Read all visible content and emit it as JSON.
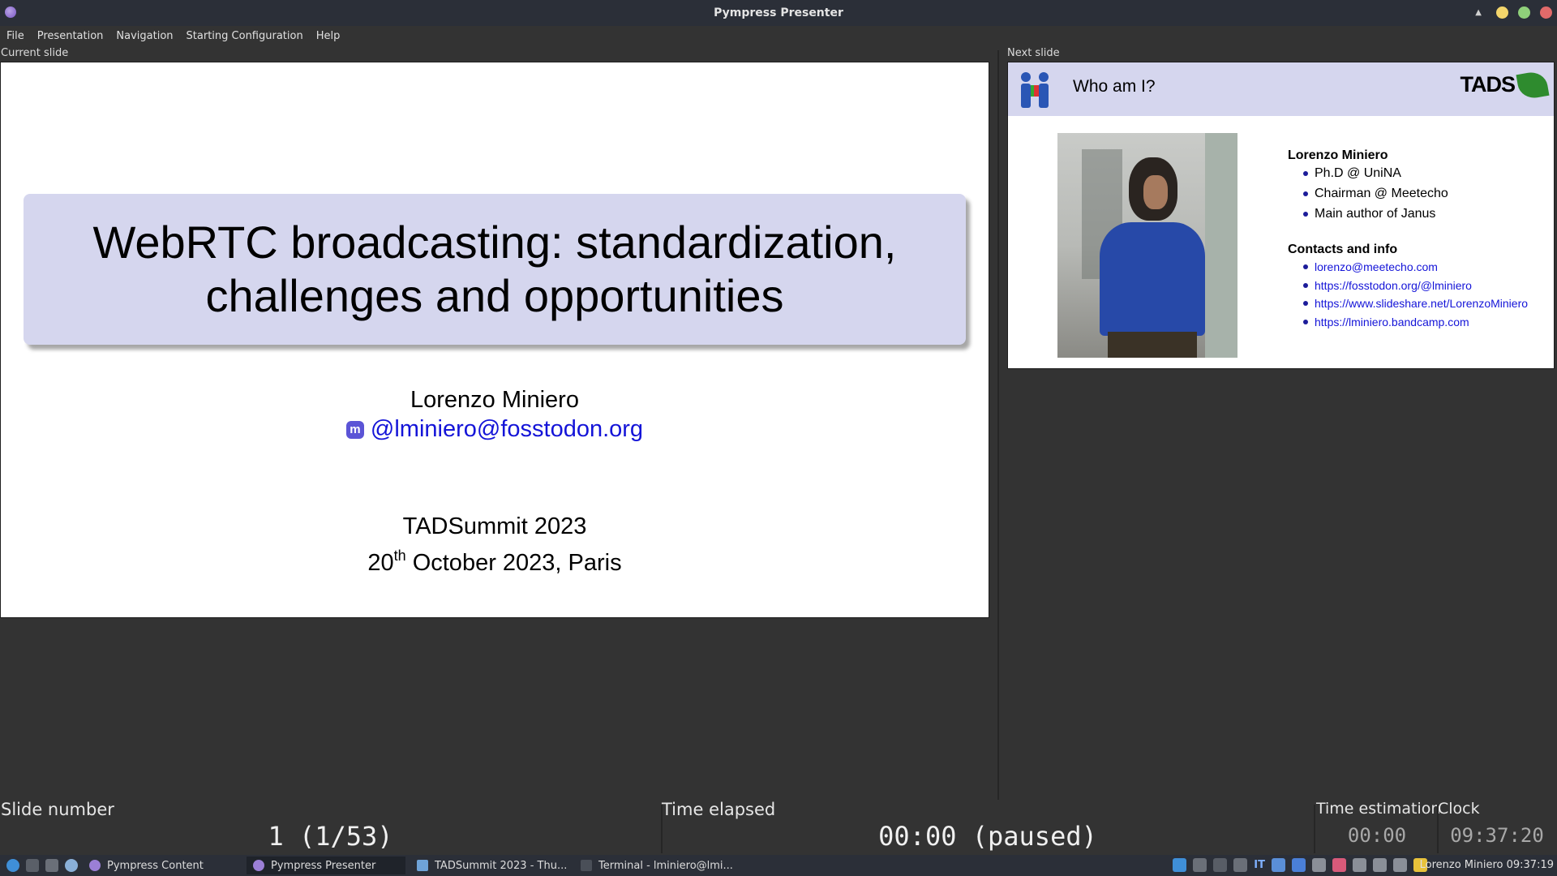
{
  "window": {
    "title": "Pympress Presenter"
  },
  "menu": [
    "File",
    "Presentation",
    "Navigation",
    "Starting Configuration",
    "Help"
  ],
  "labels": {
    "current": "Current slide",
    "next": "Next slide"
  },
  "current_slide": {
    "title_line1": "WebRTC broadcasting: standardization,",
    "title_line2": "challenges and opportunities",
    "author": "Lorenzo Miniero",
    "mastodon": "@lminiero@fosstodon.org",
    "event": "TADSummit 2023",
    "date_day": "20",
    "date_suffix": "th",
    "date_rest": " October 2023, Paris"
  },
  "next_slide": {
    "title": "Who am I?",
    "logo_text": "TADS",
    "name": "Lorenzo Miniero",
    "bullets": [
      "Ph.D @ UniNA",
      "Chairman @ Meetecho",
      "Main author of Janus"
    ],
    "contacts_heading": "Contacts and info",
    "links": [
      "lorenzo@meetecho.com",
      "https://fosstodon.org/@lminiero",
      "https://www.slideshare.net/LorenzoMiniero",
      "https://lminiero.bandcamp.com"
    ]
  },
  "status": {
    "slide_number_label": "Slide number",
    "slide_number": "1 (1/53)",
    "time_elapsed_label": "Time elapsed",
    "time_elapsed": "00:00 (paused)",
    "time_estimation_label": "Time estimation",
    "time_estimation": "00:00",
    "clock_label": "Clock",
    "clock": "09:37:20"
  },
  "taskbar": {
    "tasks": [
      "Pympress Content",
      "Pympress Presenter",
      "TADSummit 2023 - Thu...",
      "Terminal - lminiero@lmi..."
    ],
    "keyboard_layout": "IT",
    "user_clock": "Lorenzo Miniero 09:37:19"
  },
  "colors": {
    "slide_header": "#d5d6ee",
    "link": "#1414d8",
    "bg": "#333333"
  }
}
